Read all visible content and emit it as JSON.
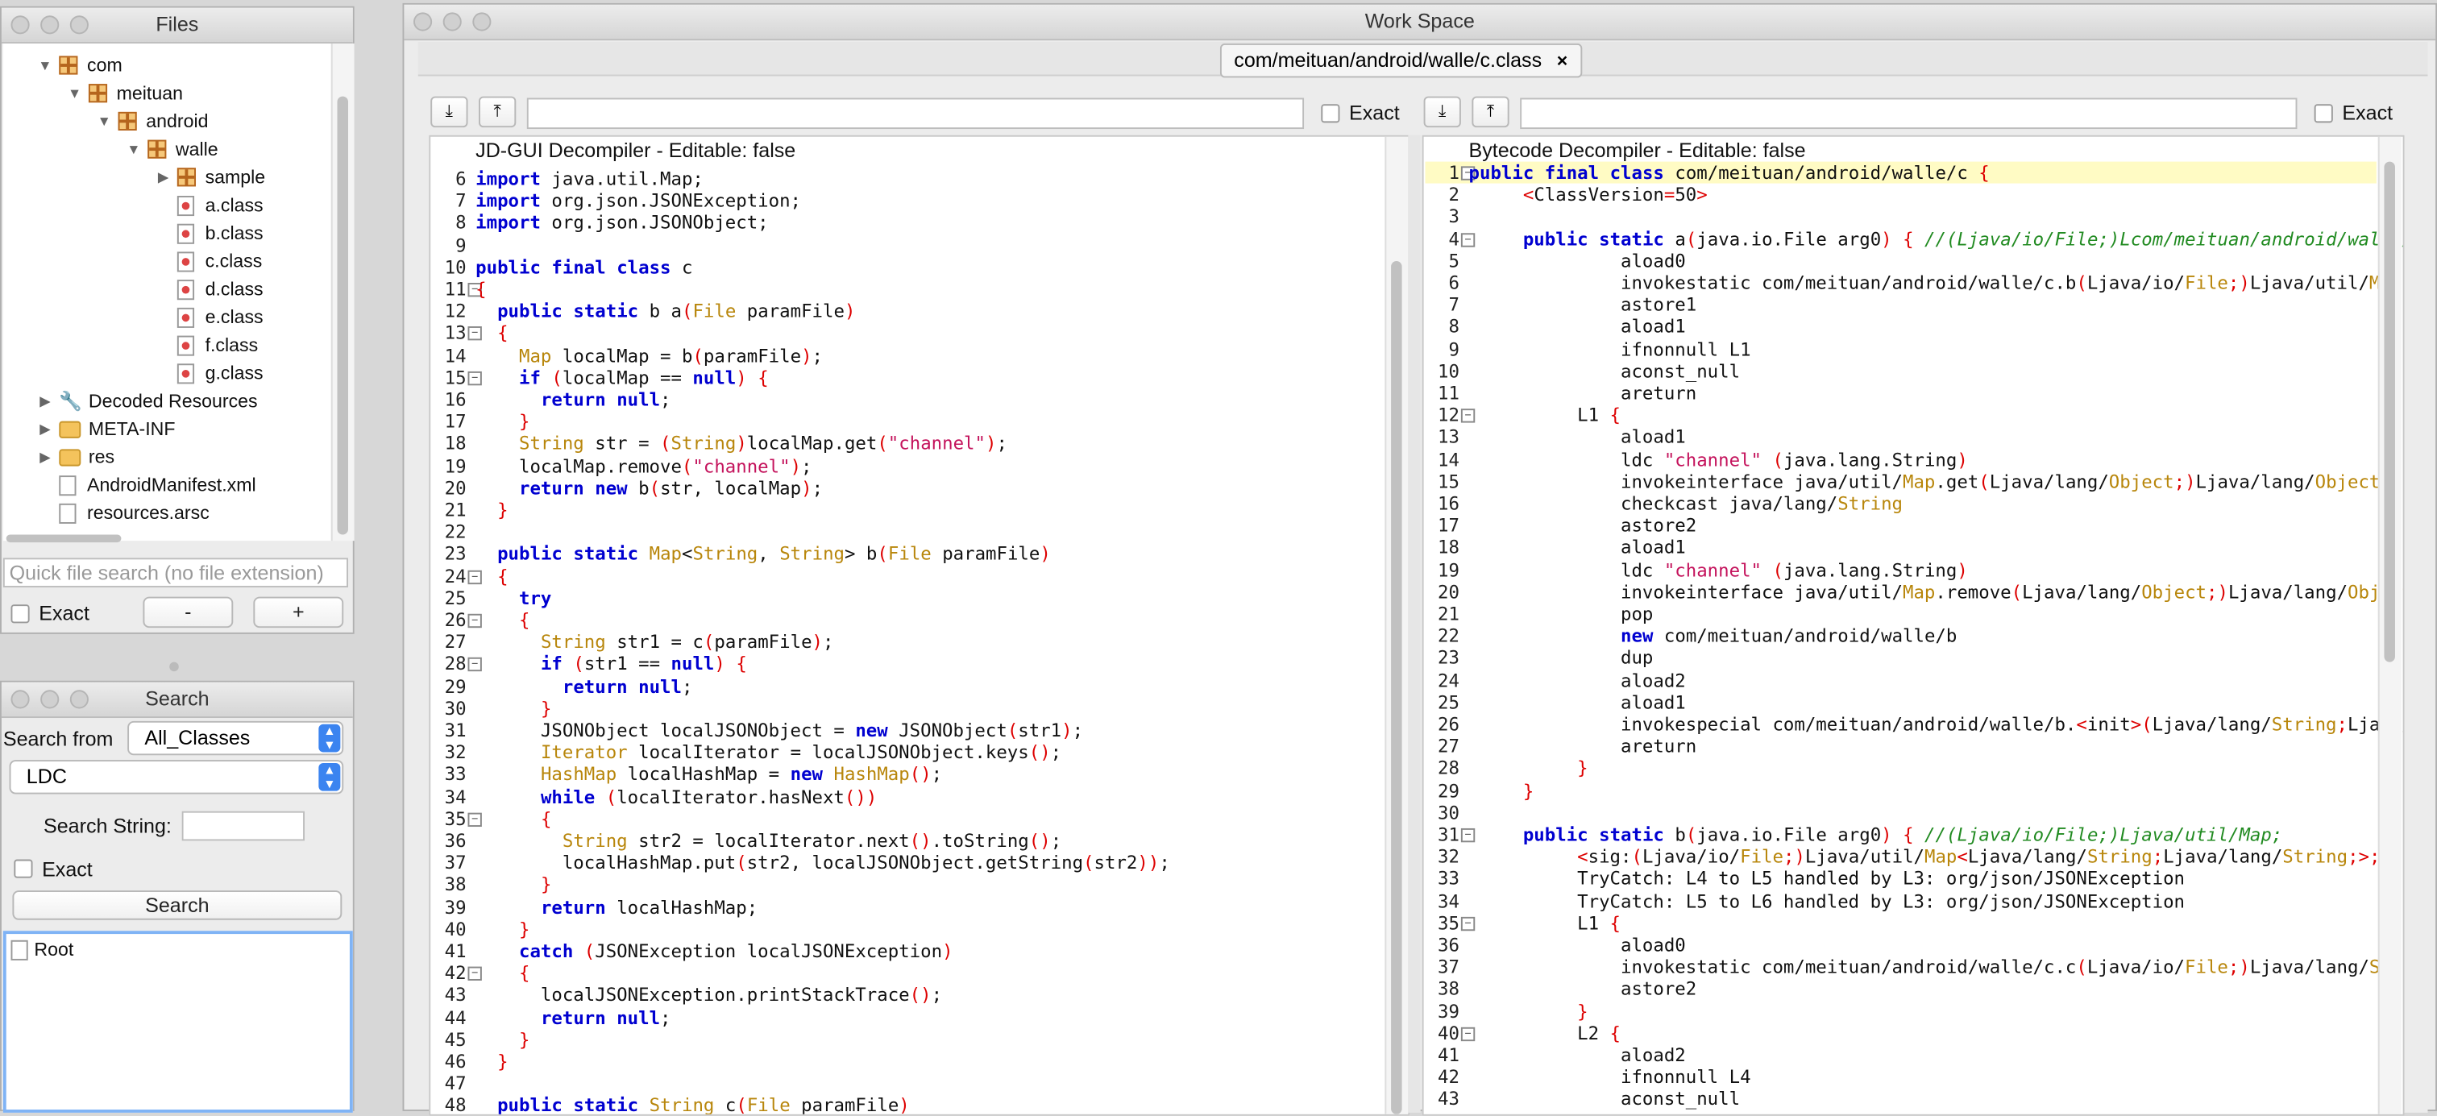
{
  "files": {
    "title": "Files",
    "tree": [
      {
        "label": "com",
        "icon": "package-icon",
        "depth": 0,
        "expanded": true
      },
      {
        "label": "meituan",
        "icon": "package-icon",
        "depth": 1,
        "expanded": true
      },
      {
        "label": "android",
        "icon": "package-icon",
        "depth": 2,
        "expanded": true
      },
      {
        "label": "walle",
        "icon": "package-icon",
        "depth": 3,
        "expanded": true
      },
      {
        "label": "sample",
        "icon": "package-icon",
        "depth": 4,
        "expanded": false
      },
      {
        "label": "a.class",
        "icon": "class-file-icon",
        "depth": 4
      },
      {
        "label": "b.class",
        "icon": "class-file-icon",
        "depth": 4
      },
      {
        "label": "c.class",
        "icon": "class-file-icon",
        "depth": 4
      },
      {
        "label": "d.class",
        "icon": "class-file-icon",
        "depth": 4
      },
      {
        "label": "e.class",
        "icon": "class-file-icon",
        "depth": 4
      },
      {
        "label": "f.class",
        "icon": "class-file-icon",
        "depth": 4
      },
      {
        "label": "g.class",
        "icon": "class-file-icon",
        "depth": 4
      },
      {
        "label": "Decoded Resources",
        "icon": "wrench-icon",
        "depth": 0,
        "expanded": false
      },
      {
        "label": "META-INF",
        "icon": "folder-icon",
        "depth": 0,
        "expanded": false
      },
      {
        "label": "res",
        "icon": "folder-icon",
        "depth": 0,
        "expanded": false
      },
      {
        "label": "AndroidManifest.xml",
        "icon": "xml-file-icon",
        "depth": 0
      },
      {
        "label": "resources.arsc",
        "icon": "file-icon",
        "depth": 0
      }
    ],
    "quick_search_placeholder": "Quick file search (no file extension)",
    "exact_label": "Exact",
    "minus_label": "-",
    "plus_label": "+"
  },
  "search": {
    "title": "Search",
    "search_from_label": "Search from",
    "search_from_value": "All_Classes",
    "type_value": "LDC",
    "search_string_label": "Search String:",
    "search_string_value": "",
    "exact_label": "Exact",
    "search_button": "Search",
    "result_root": "Root"
  },
  "workspace": {
    "title": "Work Space",
    "tab_label": "com/meituan/android/walle/c.class",
    "tab_close": "×",
    "left_pane": {
      "exact_label": "Exact",
      "header": "JD-GUI Decompiler - Editable: false",
      "lines": [
        {
          "n": "6",
          "text": "import java.util.Map;"
        },
        {
          "n": "7",
          "text": "import org.json.JSONException;"
        },
        {
          "n": "8",
          "text": "import org.json.JSONObject;"
        },
        {
          "n": "9",
          "text": ""
        },
        {
          "n": "10",
          "text": "public final class c"
        },
        {
          "n": "11",
          "text": "{"
        },
        {
          "n": "12",
          "text": "  public static b a(File paramFile)"
        },
        {
          "n": "13",
          "text": "  {"
        },
        {
          "n": "14",
          "text": "    Map localMap = b(paramFile);"
        },
        {
          "n": "15",
          "text": "    if (localMap == null) {"
        },
        {
          "n": "16",
          "text": "      return null;"
        },
        {
          "n": "17",
          "text": "    }"
        },
        {
          "n": "18",
          "text": "    String str = (String)localMap.get(\"channel\");"
        },
        {
          "n": "19",
          "text": "    localMap.remove(\"channel\");"
        },
        {
          "n": "20",
          "text": "    return new b(str, localMap);"
        },
        {
          "n": "21",
          "text": "  }"
        },
        {
          "n": "22",
          "text": ""
        },
        {
          "n": "23",
          "text": "  public static Map<String, String> b(File paramFile)"
        },
        {
          "n": "24",
          "text": "  {"
        },
        {
          "n": "25",
          "text": "    try"
        },
        {
          "n": "26",
          "text": "    {"
        },
        {
          "n": "27",
          "text": "      String str1 = c(paramFile);"
        },
        {
          "n": "28",
          "text": "      if (str1 == null) {"
        },
        {
          "n": "29",
          "text": "        return null;"
        },
        {
          "n": "30",
          "text": "      }"
        },
        {
          "n": "31",
          "text": "      JSONObject localJSONObject = new JSONObject(str1);"
        },
        {
          "n": "32",
          "text": "      Iterator localIterator = localJSONObject.keys();"
        },
        {
          "n": "33",
          "text": "      HashMap localHashMap = new HashMap();"
        },
        {
          "n": "34",
          "text": "      while (localIterator.hasNext())"
        },
        {
          "n": "35",
          "text": "      {"
        },
        {
          "n": "36",
          "text": "        String str2 = localIterator.next().toString();"
        },
        {
          "n": "37",
          "text": "        localHashMap.put(str2, localJSONObject.getString(str2));"
        },
        {
          "n": "38",
          "text": "      }"
        },
        {
          "n": "39",
          "text": "      return localHashMap;"
        },
        {
          "n": "40",
          "text": "    }"
        },
        {
          "n": "41",
          "text": "    catch (JSONException localJSONException)"
        },
        {
          "n": "42",
          "text": "    {"
        },
        {
          "n": "43",
          "text": "      localJSONException.printStackTrace();"
        },
        {
          "n": "44",
          "text": "      return null;"
        },
        {
          "n": "45",
          "text": "    }"
        },
        {
          "n": "46",
          "text": "  }"
        },
        {
          "n": "47",
          "text": ""
        },
        {
          "n": "48",
          "text": "  public static String c(File paramFile)"
        }
      ]
    },
    "right_pane": {
      "exact_label": "Exact",
      "header": "Bytecode Decompiler - Editable: false",
      "lines": [
        {
          "n": "1",
          "text": "public final class com/meituan/android/walle/c {"
        },
        {
          "n": "2",
          "text": "     <ClassVersion=50>"
        },
        {
          "n": "3",
          "text": ""
        },
        {
          "n": "4",
          "text": "     public static a(java.io.File arg0) { //(Ljava/io/File;)Lcom/meituan/android/walle/b"
        },
        {
          "n": "5",
          "text": "              aload0"
        },
        {
          "n": "6",
          "text": "              invokestatic com/meituan/android/walle/c.b(Ljava/io/File;)Ljava/util/Map;"
        },
        {
          "n": "7",
          "text": "              astore1"
        },
        {
          "n": "8",
          "text": "              aload1"
        },
        {
          "n": "9",
          "text": "              ifnonnull L1"
        },
        {
          "n": "10",
          "text": "              aconst_null"
        },
        {
          "n": "11",
          "text": "              areturn"
        },
        {
          "n": "12",
          "text": "          L1 {"
        },
        {
          "n": "13",
          "text": "              aload1"
        },
        {
          "n": "14",
          "text": "              ldc \"channel\" (java.lang.String)"
        },
        {
          "n": "15",
          "text": "              invokeinterface java/util/Map.get(Ljava/lang/Object;)Ljava/lang/Object;"
        },
        {
          "n": "16",
          "text": "              checkcast java/lang/String"
        },
        {
          "n": "17",
          "text": "              astore2"
        },
        {
          "n": "18",
          "text": "              aload1"
        },
        {
          "n": "19",
          "text": "              ldc \"channel\" (java.lang.String)"
        },
        {
          "n": "20",
          "text": "              invokeinterface java/util/Map.remove(Ljava/lang/Object;)Ljava/lang/Object;"
        },
        {
          "n": "21",
          "text": "              pop"
        },
        {
          "n": "22",
          "text": "              new com/meituan/android/walle/b"
        },
        {
          "n": "23",
          "text": "              dup"
        },
        {
          "n": "24",
          "text": "              aload2"
        },
        {
          "n": "25",
          "text": "              aload1"
        },
        {
          "n": "26",
          "text": "              invokespecial com/meituan/android/walle/b.<init>(Ljava/lang/String;Ljava/ut"
        },
        {
          "n": "27",
          "text": "              areturn"
        },
        {
          "n": "28",
          "text": "          }"
        },
        {
          "n": "29",
          "text": "     }"
        },
        {
          "n": "30",
          "text": ""
        },
        {
          "n": "31",
          "text": "     public static b(java.io.File arg0) { //(Ljava/io/File;)Ljava/util/Map;"
        },
        {
          "n": "32",
          "text": "          <sig:(Ljava/io/File;)Ljava/util/Map<Ljava/lang/String;Ljava/lang/String;>;>"
        },
        {
          "n": "33",
          "text": "          TryCatch: L4 to L5 handled by L3: org/json/JSONException"
        },
        {
          "n": "34",
          "text": "          TryCatch: L5 to L6 handled by L3: org/json/JSONException"
        },
        {
          "n": "35",
          "text": "          L1 {"
        },
        {
          "n": "36",
          "text": "              aload0"
        },
        {
          "n": "37",
          "text": "              invokestatic com/meituan/android/walle/c.c(Ljava/io/File;)Ljava/lang/String"
        },
        {
          "n": "38",
          "text": "              astore2"
        },
        {
          "n": "39",
          "text": "          }"
        },
        {
          "n": "40",
          "text": "          L2 {"
        },
        {
          "n": "41",
          "text": "              aload2"
        },
        {
          "n": "42",
          "text": "              ifnonnull L4"
        },
        {
          "n": "43",
          "text": "              aconst_null"
        }
      ]
    }
  },
  "colors": {
    "keyword": "#0000d0",
    "string": "#c4135c",
    "type": "#b8860b",
    "punct": "#d00000",
    "comment": "#228b22",
    "highlight_line": "#fffbc4"
  }
}
